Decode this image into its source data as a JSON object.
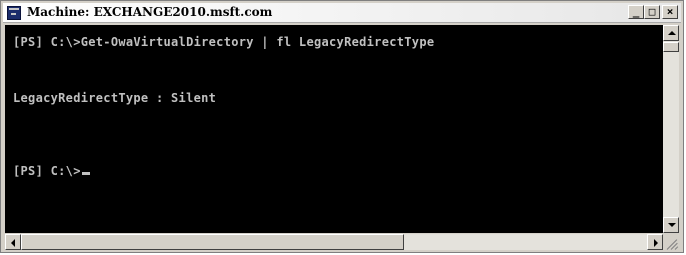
{
  "window": {
    "title": "Machine: EXCHANGE2010.msft.com",
    "minimize_label": "_",
    "maximize_label": "□",
    "close_label": "×"
  },
  "console": {
    "lines": [
      "[PS] C:\\>Get-OwaVirtualDirectory | fl LegacyRedirectType",
      "LegacyRedirectType : Silent",
      "[PS] C:\\>"
    ]
  },
  "icons": {
    "window": "powershell-console-icon",
    "minimize": "minimize-icon",
    "maximize": "maximize-icon",
    "close": "close-icon",
    "scroll_up": "arrow-up-icon",
    "scroll_down": "arrow-down-icon",
    "scroll_left": "arrow-left-icon",
    "scroll_right": "arrow-right-icon",
    "resize": "resize-grip-icon"
  },
  "colors": {
    "console_background": "#000000",
    "console_text": "#c0c0c0",
    "chrome": "#d4d0c8"
  }
}
